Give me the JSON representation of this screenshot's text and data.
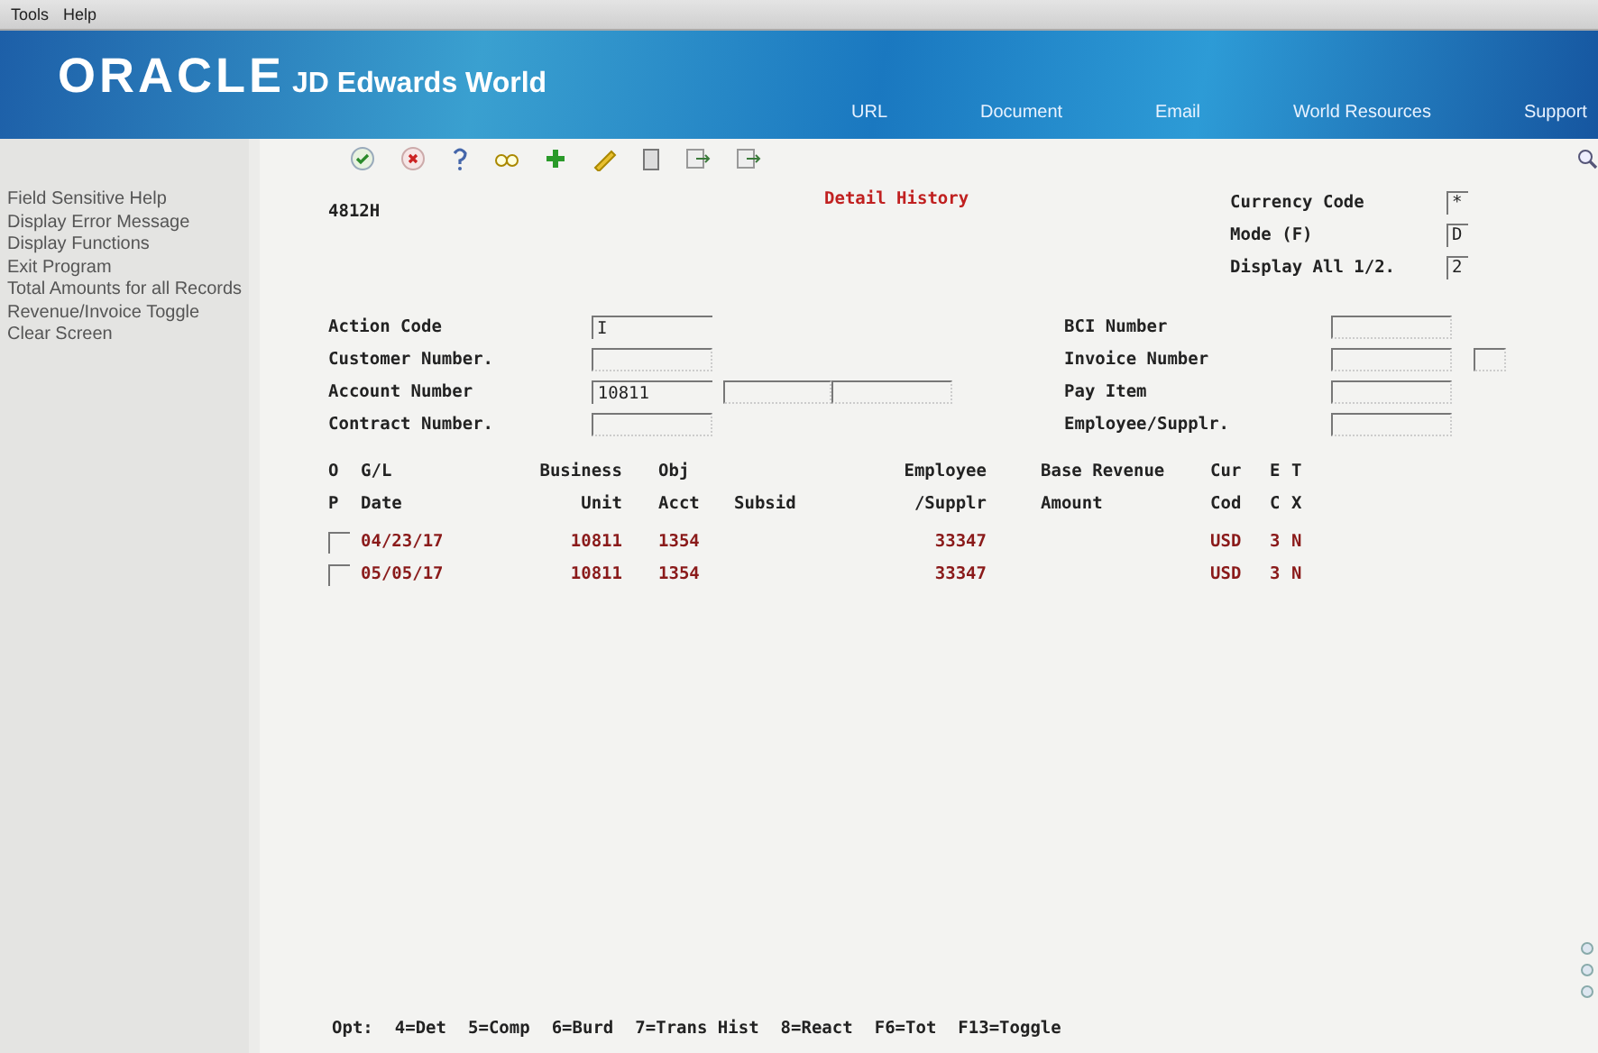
{
  "menu_bar": [
    "Tools",
    "Help"
  ],
  "banner": {
    "logo": "ORACLE",
    "product": "JD Edwards World",
    "links": [
      "URL",
      "Document",
      "Email",
      "World Resources",
      "Support"
    ]
  },
  "sidebar": {
    "items": [
      "Field Sensitive Help",
      "Display Error Message",
      "Display Functions",
      "Exit Program",
      "Total Amounts for all Records",
      "Revenue/Invoice Toggle",
      "Clear Screen"
    ]
  },
  "form": {
    "program_id": "4812H",
    "title": "Detail History",
    "header_fields": [
      {
        "label": "Currency Code",
        "value": "*"
      },
      {
        "label": "Mode (F)",
        "value": "D"
      },
      {
        "label": "Display All 1/2.",
        "value": "2"
      }
    ],
    "left_fields": [
      {
        "label": "Action Code",
        "inputs": [
          {
            "kind": "filled",
            "value": "I"
          }
        ]
      },
      {
        "label": "Customer Number.",
        "inputs": [
          {
            "kind": "blank"
          }
        ]
      },
      {
        "label": "Account Number",
        "inputs": [
          {
            "kind": "filled",
            "value": "10811"
          },
          {
            "kind": "blank"
          },
          {
            "kind": "blank"
          }
        ]
      },
      {
        "label": "Contract Number.",
        "inputs": [
          {
            "kind": "blank"
          }
        ]
      }
    ],
    "right_fields": [
      {
        "label": "BCI Number",
        "inputs": [
          {
            "kind": "blank"
          }
        ]
      },
      {
        "label": "Invoice Number",
        "inputs": [
          {
            "kind": "blank"
          },
          {
            "kind": "blank"
          }
        ]
      },
      {
        "label": "Pay Item",
        "inputs": [
          {
            "kind": "blank"
          }
        ]
      },
      {
        "label": "Employee/Supplr.",
        "inputs": [
          {
            "kind": "blank"
          }
        ]
      }
    ]
  },
  "table": {
    "columns": [
      "O\nP",
      "G/L\nDate",
      "Business\nUnit",
      "Obj\nAcct",
      "Subsid",
      "Employee\n/Supplr",
      "Base Revenue\nAmount",
      "Cur\nCod",
      "E\nC",
      "T\nX"
    ],
    "rows": [
      [
        "",
        "04/23/17",
        "10811",
        "1354",
        "",
        "33347",
        "",
        "USD",
        "3",
        "N"
      ],
      [
        "",
        "05/05/17",
        "10811",
        "1354",
        "",
        "33347",
        "",
        "USD",
        "3",
        "N"
      ]
    ]
  },
  "footer": {
    "label": "Opt:",
    "options": [
      "4=Det",
      "5=Comp",
      "6=Burd",
      "7=Trans Hist",
      "8=React",
      "F6=Tot",
      "F13=Toggle"
    ]
  }
}
